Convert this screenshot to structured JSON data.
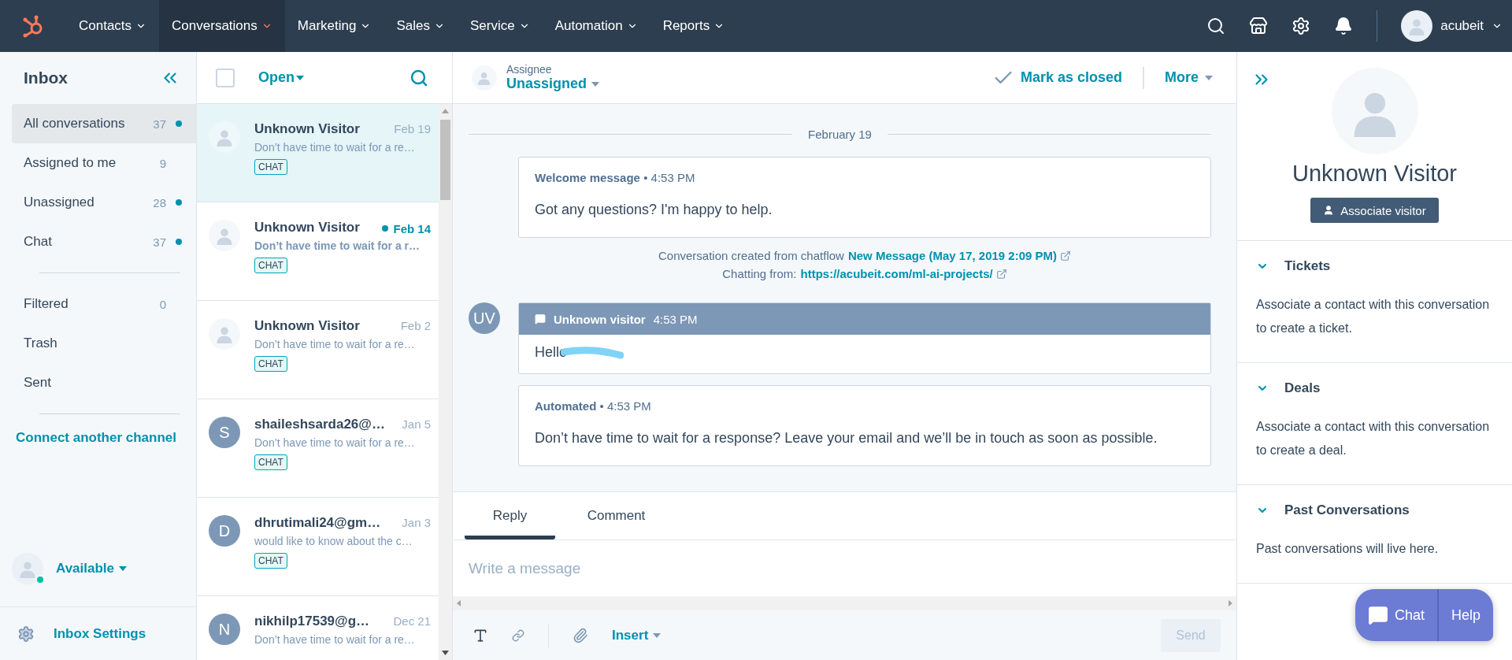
{
  "nav": {
    "items": [
      {
        "label": "Contacts",
        "selected": false
      },
      {
        "label": "Conversations",
        "selected": true
      },
      {
        "label": "Marketing",
        "selected": false
      },
      {
        "label": "Sales",
        "selected": false
      },
      {
        "label": "Service",
        "selected": false
      },
      {
        "label": "Automation",
        "selected": false
      },
      {
        "label": "Reports",
        "selected": false
      }
    ],
    "user": "acubeit"
  },
  "sidebar": {
    "title": "Inbox",
    "groups": [
      [
        {
          "label": "All conversations",
          "count": "37",
          "unread": true,
          "selected": true
        },
        {
          "label": "Assigned to me",
          "count": "9",
          "unread": false,
          "selected": false
        },
        {
          "label": "Unassigned",
          "count": "28",
          "unread": true,
          "selected": false
        },
        {
          "label": "Chat",
          "count": "37",
          "unread": true,
          "selected": false
        }
      ],
      [
        {
          "label": "Filtered",
          "count": "0",
          "unread": false,
          "selected": false
        },
        {
          "label": "Trash",
          "unread": false,
          "selected": false
        },
        {
          "label": "Sent",
          "unread": false,
          "selected": false
        }
      ]
    ],
    "connect_link": "Connect another channel",
    "status": {
      "label": "Available",
      "online": true
    },
    "settings": "Inbox Settings"
  },
  "list": {
    "filter": "Open",
    "select_all": {
      "checked": false
    },
    "conversations": [
      {
        "name": "Unknown Visitor",
        "date": "Feb 19",
        "preview": "Don’t have time to wait for a re…",
        "tag": "CHAT",
        "selected": true,
        "unread": false
      },
      {
        "name": "Unknown Visitor",
        "date": "Feb 14",
        "preview": "Don’t have time to wait for a r…",
        "tag": "CHAT",
        "selected": false,
        "unread": true
      },
      {
        "name": "Unknown Visitor",
        "date": "Feb 2",
        "preview": "Don’t have time to wait for a re…",
        "tag": "CHAT",
        "selected": false,
        "unread": false
      },
      {
        "name": "shaileshsarda26@…",
        "date": "Jan 5",
        "preview": "Don’t have time to wait for a re…",
        "tag": "CHAT",
        "initial": "S",
        "selected": false,
        "unread": false
      },
      {
        "name": "dhrutimali24@gm…",
        "date": "Jan 3",
        "preview": "would like to know about the c…",
        "tag": "CHAT",
        "initial": "D",
        "selected": false,
        "unread": false
      },
      {
        "name": "nikhilp17539@g…",
        "date": "Dec 21",
        "preview": "Don’t have time to wait for a re…",
        "initial": "N",
        "selected": false,
        "unread": false
      }
    ]
  },
  "thread": {
    "assignee_label": "Assignee",
    "assignee": "Unassigned",
    "close_action": "Mark as closed",
    "more": "More",
    "date_divider": "February 19",
    "messages": [
      {
        "kind": "card",
        "sender": "Welcome message",
        "separator": "•",
        "time": "4:53 PM",
        "body": "Got any questions? I'm happy to help."
      },
      {
        "kind": "info",
        "lines": [
          {
            "text": "Conversation created from chatflow",
            "link": "New Message (May 17, 2019 2:09 PM)"
          },
          {
            "text": "Chatting from:",
            "link": "https://acubeit.com/ml-ai-projects/"
          }
        ]
      },
      {
        "kind": "visitor",
        "initials": "UV",
        "sender": "Unknown visitor",
        "time": "4:53 PM",
        "body": "Hello"
      },
      {
        "kind": "card",
        "sender": "Automated",
        "separator": "•",
        "time": "4:53 PM",
        "body": "Don’t have time to wait for a response? Leave your email and we’ll be in touch as soon as possible."
      }
    ]
  },
  "composer": {
    "tabs": [
      {
        "label": "Reply",
        "selected": true
      },
      {
        "label": "Comment",
        "selected": false
      }
    ],
    "placeholder": "Write a message",
    "insert": "Insert",
    "send": {
      "label": "Send",
      "disabled": true
    }
  },
  "contact": {
    "name": "Unknown Visitor",
    "button": "Associate visitor",
    "sections": [
      {
        "title": "Tickets",
        "body": "Associate a contact with this conversation to create a ticket.",
        "expanded": true
      },
      {
        "title": "Deals",
        "body": "Associate a contact with this conversation to create a deal.",
        "expanded": true
      },
      {
        "title": "Past Conversations",
        "body": "Past conversations will live here.",
        "expanded": true
      }
    ]
  },
  "widget": {
    "chat": "Chat",
    "help": "Help"
  }
}
